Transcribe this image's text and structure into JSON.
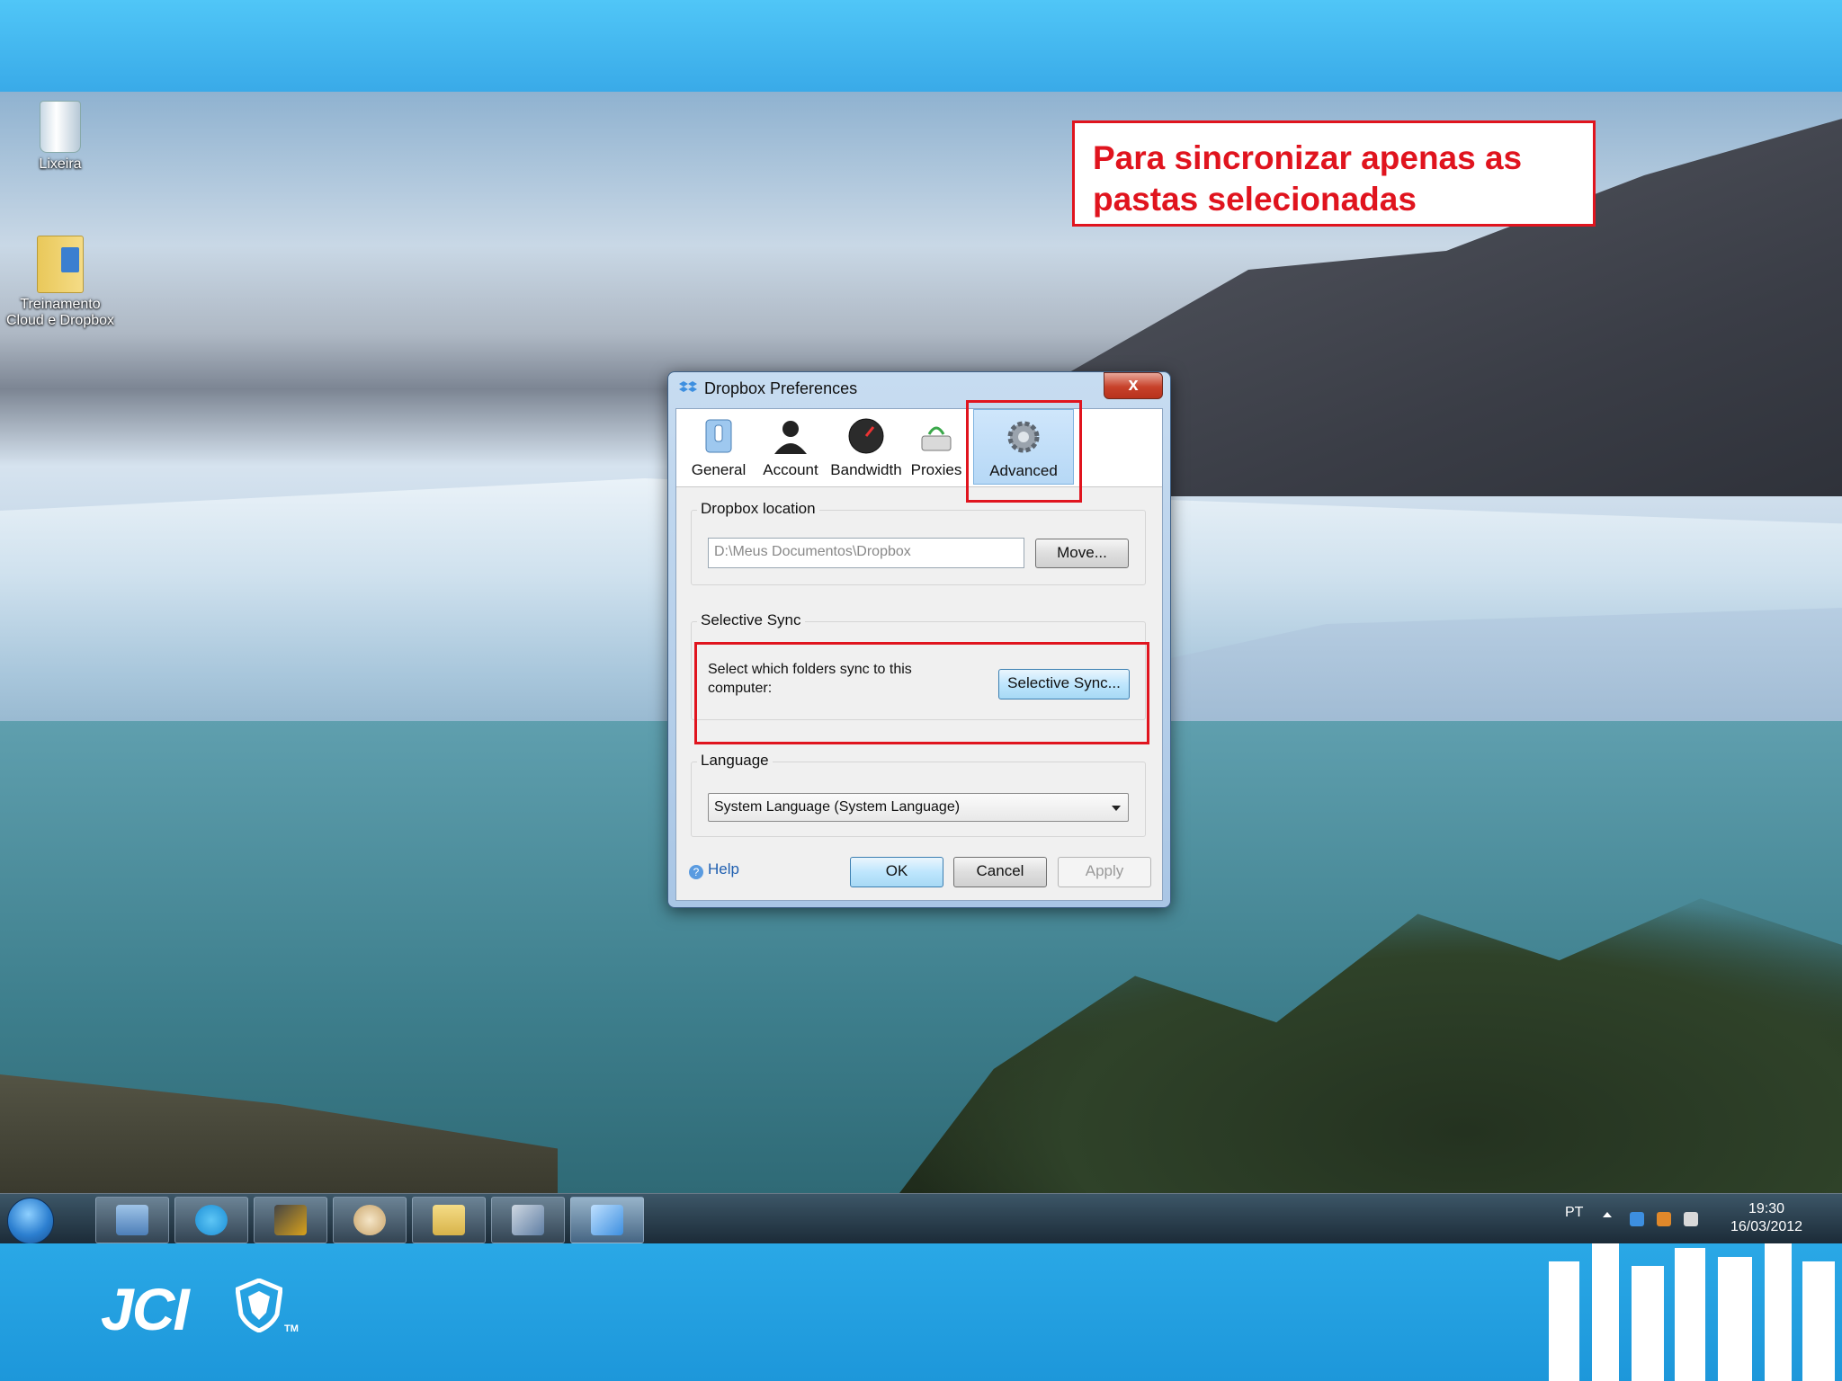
{
  "desktop": {
    "icons": [
      {
        "label": "Lixeira",
        "icon": "recycle-bin-icon"
      },
      {
        "label": "Treinamento Cloud e Dropbox",
        "icon": "folder-icon"
      }
    ]
  },
  "callout": {
    "text_line1": "Para sincronizar apenas as",
    "text_line2": "pastas selecionadas"
  },
  "dialog": {
    "title": "Dropbox Preferences",
    "close_label": "x",
    "tabs": [
      {
        "label": "General",
        "icon": "general-switch-icon"
      },
      {
        "label": "Account",
        "icon": "account-person-icon"
      },
      {
        "label": "Bandwidth",
        "icon": "bandwidth-gauge-icon"
      },
      {
        "label": "Proxies",
        "icon": "proxies-network-icon"
      },
      {
        "label": "Advanced",
        "icon": "advanced-gear-icon",
        "active": true
      }
    ],
    "location": {
      "label": "Dropbox location",
      "value": "D:\\Meus Documentos\\Dropbox",
      "move_button": "Move..."
    },
    "selective_sync": {
      "label": "Selective Sync",
      "description_line1": "Select which folders sync to this",
      "description_line2": "computer:",
      "button": "Selective Sync..."
    },
    "language": {
      "label": "Language",
      "selected": "System Language (System Language)"
    },
    "help_label": "Help",
    "ok_label": "OK",
    "cancel_label": "Cancel",
    "apply_label": "Apply"
  },
  "taskbar": {
    "apps": [
      "users-icon",
      "skype-icon",
      "winamp-icon",
      "paint-icon",
      "explorer-icon",
      "virtualbox-icon",
      "dropbox-icon"
    ],
    "active_app": "dropbox-icon",
    "tray": {
      "language": "PT",
      "time": "19:30",
      "date": "16/03/2012"
    }
  },
  "branding": {
    "logo_text": "JCI",
    "trademark": "TM"
  },
  "colors": {
    "accent_red": "#e0141e",
    "band_blue": "#2aa8e6"
  }
}
